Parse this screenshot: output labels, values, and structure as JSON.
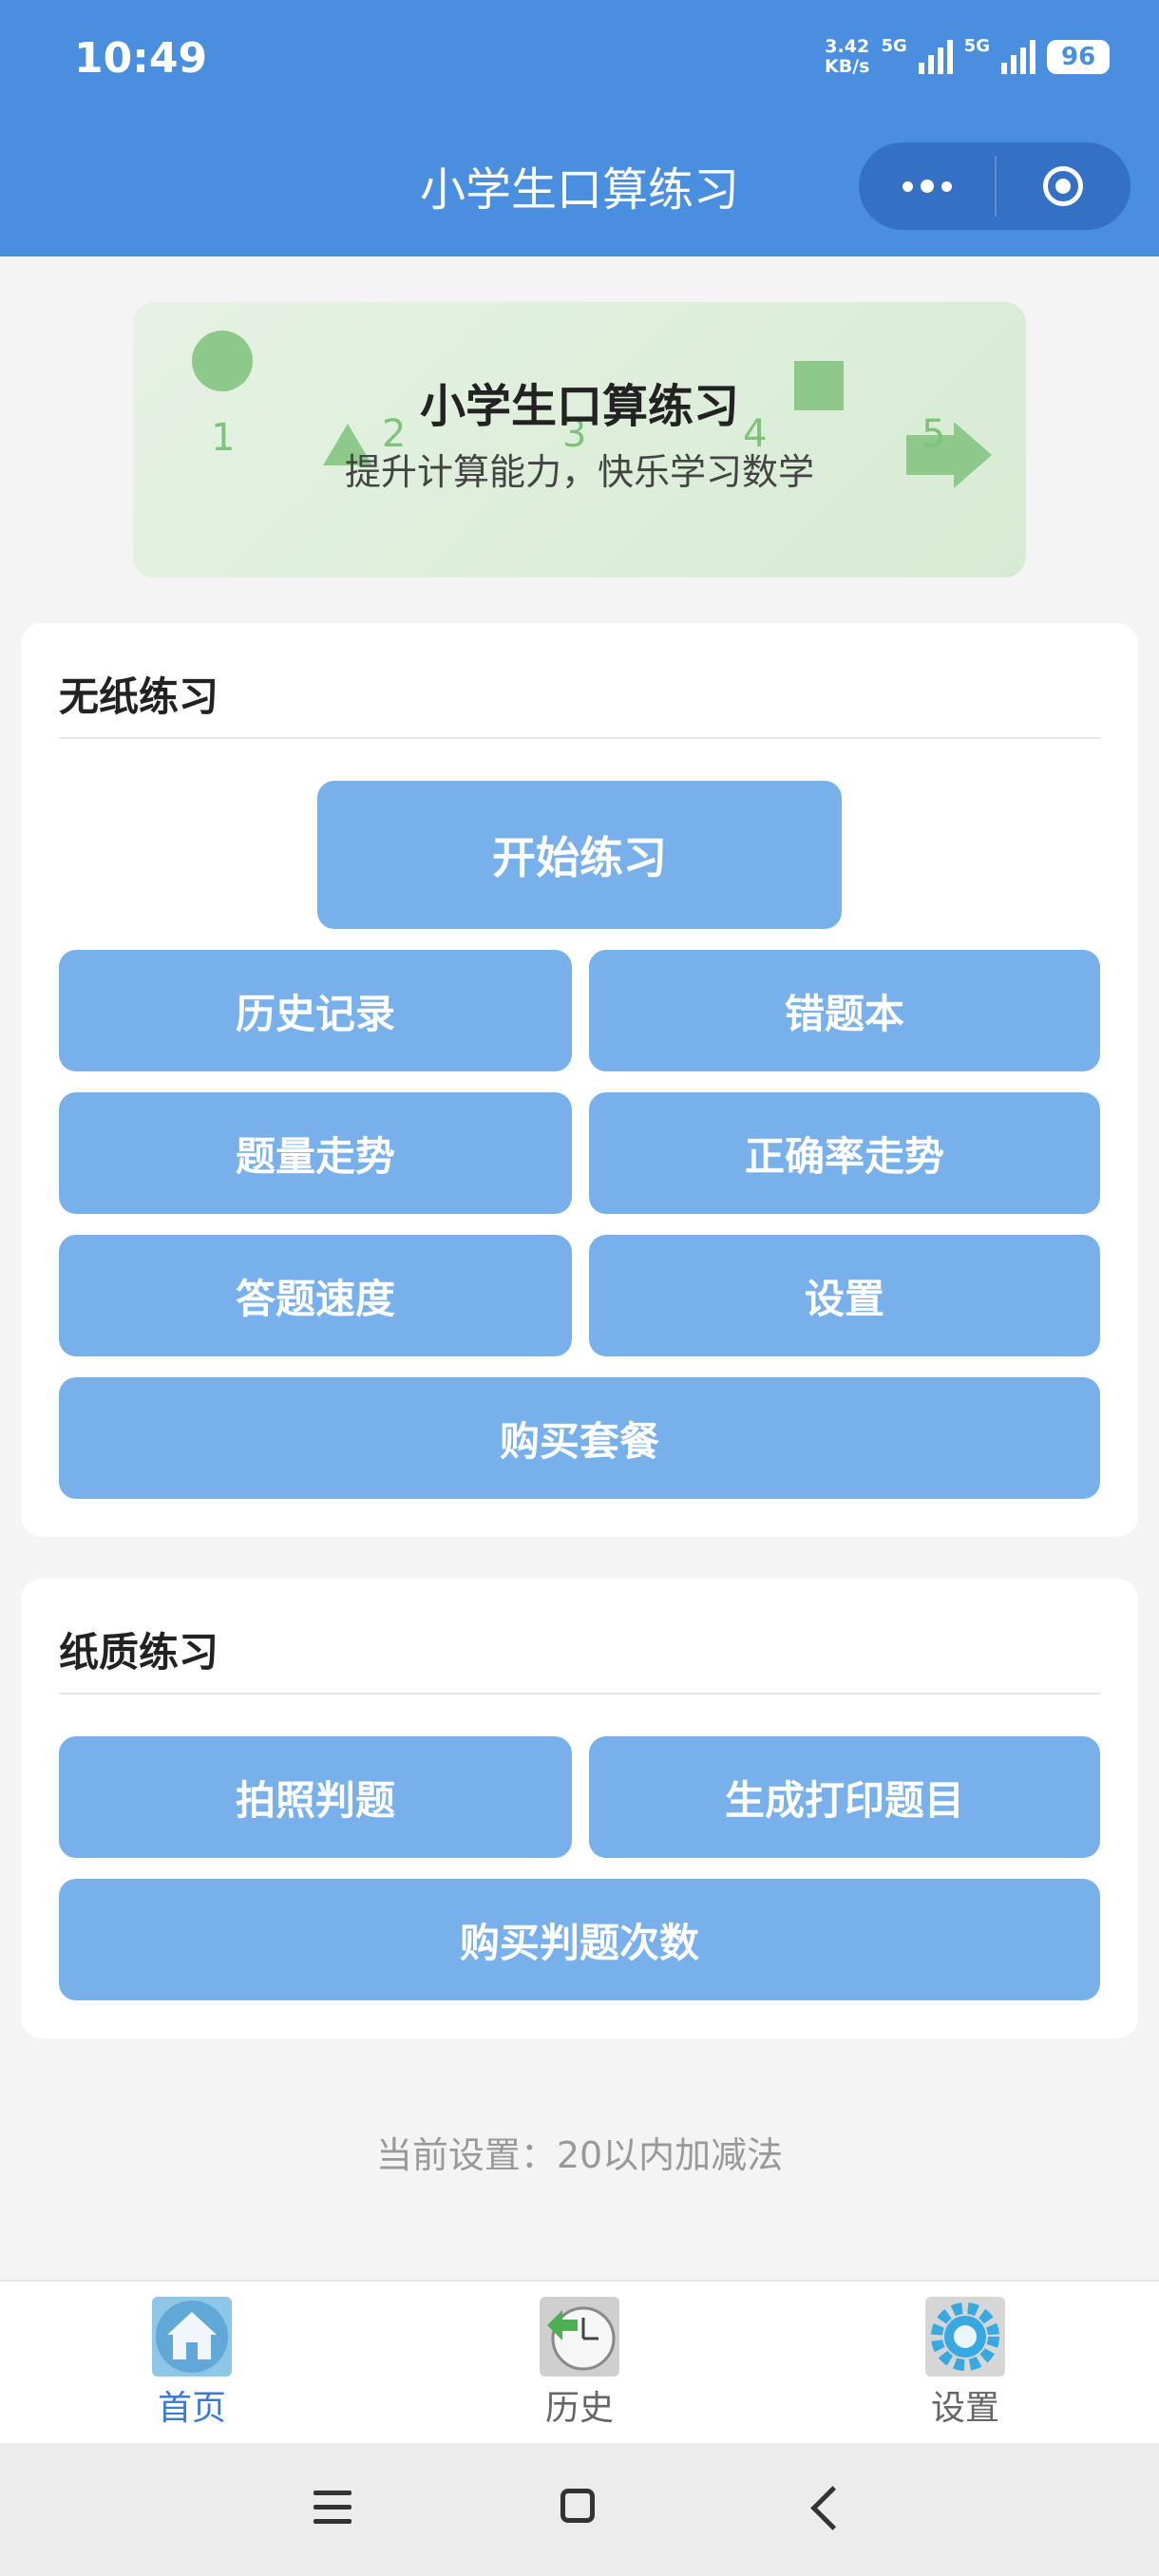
{
  "status_bar": {
    "time": "10:49",
    "net_speed_value": "3.42",
    "net_speed_unit": "KB/s",
    "signal1_label": "5G",
    "signal2_label": "5G",
    "battery": "96"
  },
  "header": {
    "title": "小学生口算练习"
  },
  "banner": {
    "title": "小学生口算练习",
    "subtitle": "提升计算能力，快乐学习数学",
    "numbers": [
      "1",
      "2",
      "3",
      "4",
      "5"
    ]
  },
  "paperless_section": {
    "title": "无纸练习",
    "start_button": "开始练习",
    "history_button": "历史记录",
    "wrong_book_button": "错题本",
    "volume_trend_button": "题量走势",
    "accuracy_trend_button": "正确率走势",
    "speed_button": "答题速度",
    "settings_button": "设置",
    "buy_package_button": "购买套餐"
  },
  "paper_section": {
    "title": "纸质练习",
    "photo_grade_button": "拍照判题",
    "print_button": "生成打印题目",
    "buy_grade_button": "购买判题次数"
  },
  "current_setting": "当前设置：20以内加减法",
  "tabbar": {
    "tabs": [
      {
        "label": "首页",
        "icon": "home-icon",
        "active": true
      },
      {
        "label": "历史",
        "icon": "clock-icon",
        "active": false
      },
      {
        "label": "设置",
        "icon": "gear-icon",
        "active": false
      }
    ]
  },
  "colors": {
    "header": "#4a8ee0",
    "button": "#78b0ec",
    "active_tab": "#3a7bd5",
    "banner_shape": "#8cc98a"
  }
}
